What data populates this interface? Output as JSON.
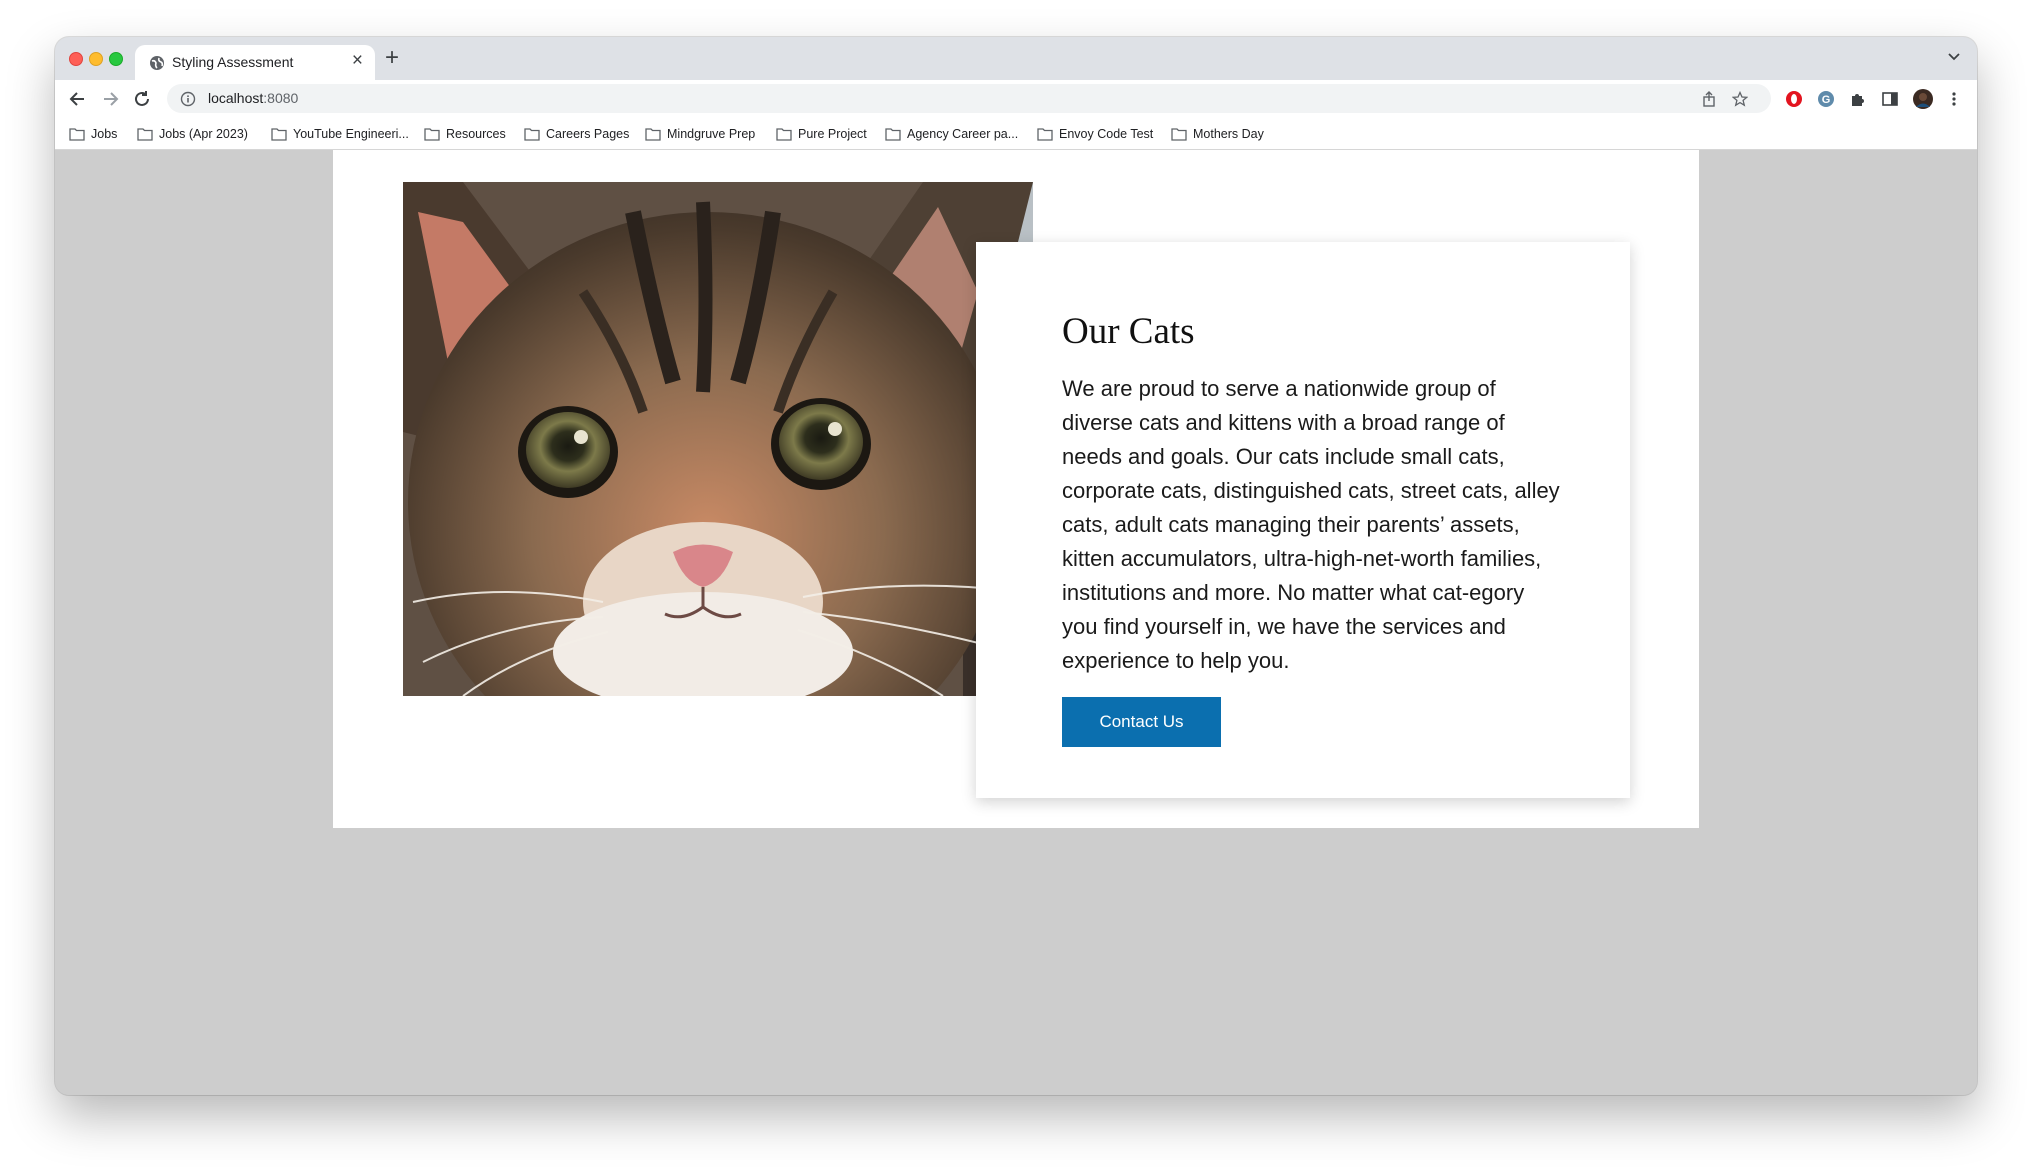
{
  "browser": {
    "tab": {
      "title": "Styling Assessment"
    },
    "address": {
      "host": "localhost",
      "port": ":8080"
    },
    "bookmarks": [
      {
        "label": "Jobs"
      },
      {
        "label": "Jobs (Apr 2023)"
      },
      {
        "label": "YouTube Engineeri..."
      },
      {
        "label": "Resources"
      },
      {
        "label": "Careers Pages"
      },
      {
        "label": "Mindgruve Prep"
      },
      {
        "label": "Pure Project"
      },
      {
        "label": "Agency Career pa..."
      },
      {
        "label": "Envoy Code Test"
      },
      {
        "label": "Mothers Day"
      }
    ]
  },
  "page": {
    "title": "Our Cats",
    "body": "We are proud to serve a nationwide group of diverse cats and kittens with a broad range of needs and goals. Our cats include small cats, corporate cats, distinguished cats, street cats, alley cats, adult cats managing their parents’ assets, kitten accumulators, ultra-high-net-worth families, institutions and more. No matter what cat-egory you find yourself in, we have the services and experience to help you.",
    "cta_label": "Contact Us",
    "image_subject": "tabby kitten face close-up"
  },
  "colors": {
    "cta_background": "#0b6faf",
    "page_background": "#cdcdcd",
    "card_background": "#ffffff"
  }
}
